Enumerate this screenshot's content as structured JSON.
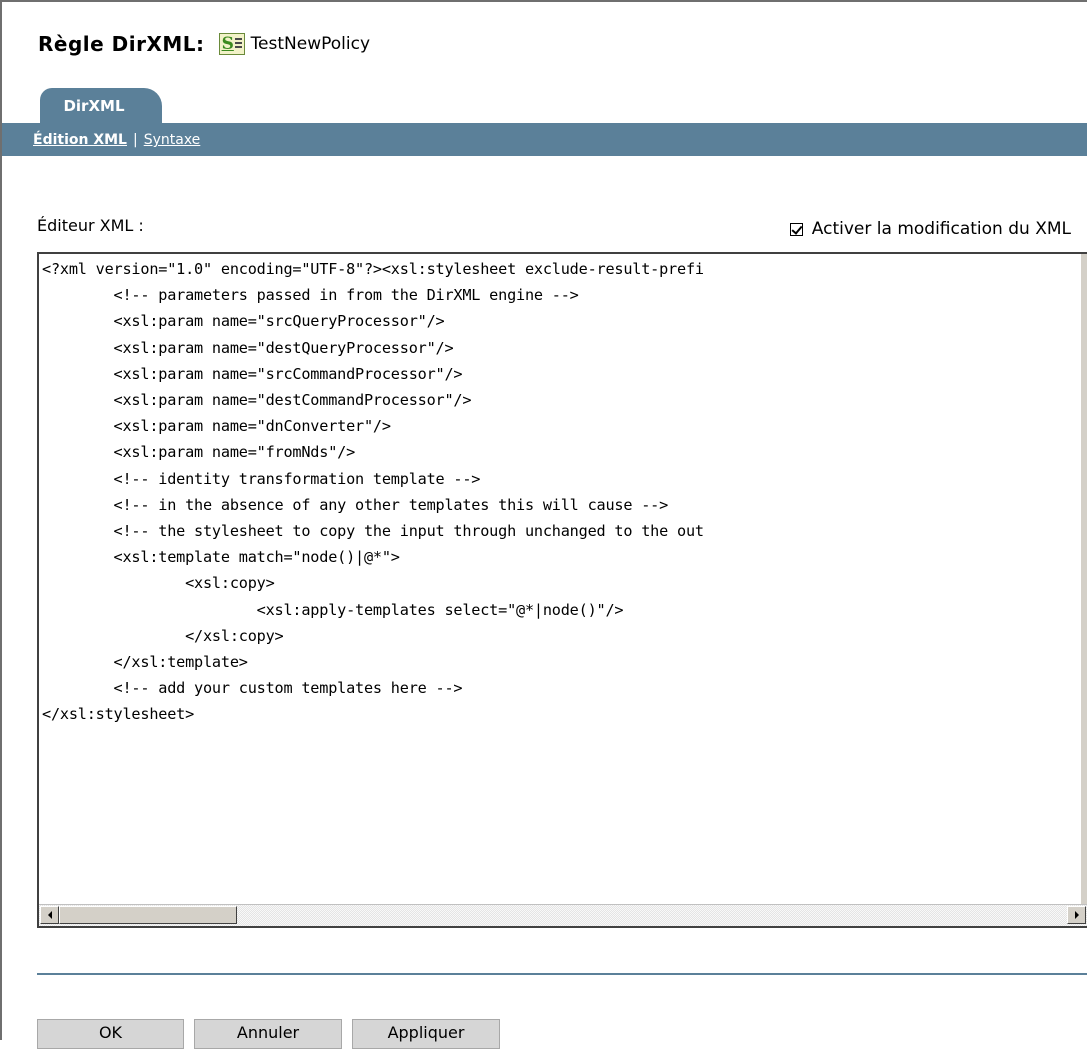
{
  "header": {
    "title_label": "Règle DirXML:",
    "policy_icon": "policy-sheet-icon",
    "policy_name": "TestNewPolicy"
  },
  "tabs": [
    {
      "label": "DirXML",
      "active": true
    }
  ],
  "subnav": {
    "active": "Édition XML",
    "separator": "|",
    "link": "Syntaxe"
  },
  "editor": {
    "label": "Éditeur XML :",
    "enable_checkbox": {
      "label": "Activer la modification du XML",
      "checked": true
    },
    "lines": [
      "<?xml version=\"1.0\" encoding=\"UTF-8\"?><xsl:stylesheet exclude-result-prefi",
      "        <!-- parameters passed in from the DirXML engine -->",
      "        <xsl:param name=\"srcQueryProcessor\"/>",
      "        <xsl:param name=\"destQueryProcessor\"/>",
      "        <xsl:param name=\"srcCommandProcessor\"/>",
      "        <xsl:param name=\"destCommandProcessor\"/>",
      "        <xsl:param name=\"dnConverter\"/>",
      "        <xsl:param name=\"fromNds\"/>",
      "        <!-- identity transformation template -->",
      "        <!-- in the absence of any other templates this will cause -->",
      "        <!-- the stylesheet to copy the input through unchanged to the out",
      "        <xsl:template match=\"node()|@*\">",
      "                <xsl:copy>",
      "                        <xsl:apply-templates select=\"@*|node()\"/>",
      "                </xsl:copy>",
      "        </xsl:template>",
      "        <!-- add your custom templates here -->",
      "</xsl:stylesheet>"
    ],
    "scrollbar": {
      "left_icon": "arrow-left-icon",
      "right_icon": "arrow-right-icon"
    }
  },
  "buttons": {
    "ok": "OK",
    "cancel": "Annuler",
    "apply": "Appliquer"
  }
}
